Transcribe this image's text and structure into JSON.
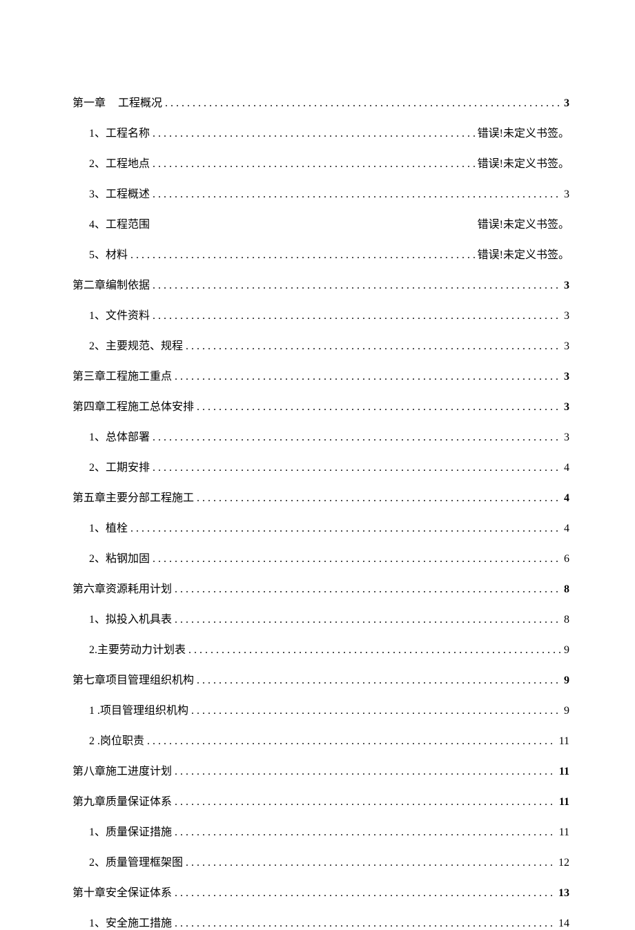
{
  "toc": [
    {
      "level": 1,
      "prefix": "第一章",
      "gap": true,
      "title": "工程概况",
      "page": "3",
      "bold": true,
      "dots": true
    },
    {
      "level": 2,
      "prefix": "1、",
      "gap": false,
      "title": "工程名称",
      "page": "错误!未定义书签。",
      "bold": false,
      "dots": true
    },
    {
      "level": 2,
      "prefix": "2、",
      "gap": false,
      "title": "工程地点",
      "page": "错误!未定义书签。",
      "bold": false,
      "dots": true
    },
    {
      "level": 2,
      "prefix": "3、",
      "gap": false,
      "title": "工程概述",
      "page": "3",
      "bold": false,
      "dots": true
    },
    {
      "level": 2,
      "prefix": "4、",
      "gap": false,
      "title": "工程范围",
      "page": "错误!未定义书签。",
      "bold": false,
      "dots": false
    },
    {
      "level": 2,
      "prefix": "5、",
      "gap": false,
      "title": "材料",
      "page": "错误!未定义书签。",
      "bold": false,
      "dots": true
    },
    {
      "level": 1,
      "prefix": "第二章",
      "gap": false,
      "title": "编制依据",
      "page": "3",
      "bold": true,
      "dots": true
    },
    {
      "level": 2,
      "prefix": "1、",
      "gap": false,
      "title": "文件资料",
      "page": "3",
      "bold": false,
      "dots": true
    },
    {
      "level": 2,
      "prefix": "2、",
      "gap": false,
      "title": "主要规范、规程",
      "page": "3",
      "bold": false,
      "dots": true
    },
    {
      "level": 1,
      "prefix": "第三章",
      "gap": false,
      "title": "工程施工重点",
      "page": "3",
      "bold": true,
      "dots": true
    },
    {
      "level": 1,
      "prefix": "第四章",
      "gap": false,
      "title": "工程施工总体安排",
      "page": "3",
      "bold": true,
      "dots": true
    },
    {
      "level": 2,
      "prefix": "1、",
      "gap": false,
      "title": "总体部署",
      "page": "3",
      "bold": false,
      "dots": true
    },
    {
      "level": 2,
      "prefix": "2、",
      "gap": false,
      "title": "工期安排",
      "page": "4",
      "bold": false,
      "dots": true
    },
    {
      "level": 1,
      "prefix": "第五章",
      "gap": false,
      "title": "主要分部工程施工",
      "page": "4",
      "bold": true,
      "dots": true
    },
    {
      "level": 2,
      "prefix": "1、",
      "gap": false,
      "title": "植栓",
      "page": "4",
      "bold": false,
      "dots": true
    },
    {
      "level": 2,
      "prefix": "2、",
      "gap": false,
      "title": "粘钢加固",
      "page": "6",
      "bold": false,
      "dots": true
    },
    {
      "level": 1,
      "prefix": "第六章",
      "gap": false,
      "title": "资源耗用计划",
      "page": "8",
      "bold": true,
      "dots": true
    },
    {
      "level": 2,
      "prefix": "1、",
      "gap": false,
      "title": "拟投入机具表",
      "page": "8",
      "bold": false,
      "dots": true
    },
    {
      "level": 2,
      "prefix": "2.",
      "gap": false,
      "title": "主要劳动力计划表",
      "page": "9",
      "bold": false,
      "dots": true
    },
    {
      "level": 1,
      "prefix": "第七章",
      "gap": false,
      "title": "项目管理组织机构",
      "page": "9",
      "bold": true,
      "dots": true
    },
    {
      "level": 2,
      "prefix": "1 .",
      "gap": false,
      "title": "项目管理组织机构",
      "page": "9",
      "bold": false,
      "dots": true
    },
    {
      "level": 2,
      "prefix": "2  .",
      "gap": false,
      "title": "岗位职责",
      "page": "11",
      "bold": false,
      "dots": true
    },
    {
      "level": 1,
      "prefix": "第八章",
      "gap": false,
      "title": "施工进度计划",
      "page": "11",
      "bold": true,
      "dots": true
    },
    {
      "level": 1,
      "prefix": "第九章",
      "gap": false,
      "title": "质量保证体系",
      "page": "11",
      "bold": true,
      "dots": true
    },
    {
      "level": 2,
      "prefix": "1、",
      "gap": false,
      "title": "质量保证措施",
      "page": "11",
      "bold": false,
      "dots": true
    },
    {
      "level": 2,
      "prefix": "2、",
      "gap": false,
      "title": "质量管理框架图",
      "page": "12",
      "bold": false,
      "dots": true
    },
    {
      "level": 1,
      "prefix": "第十章",
      "gap": false,
      "title": "安全保证体系",
      "page": "13",
      "bold": true,
      "dots": true
    },
    {
      "level": 2,
      "prefix": "1、",
      "gap": false,
      "title": "安全施工措施",
      "page": "14",
      "bold": false,
      "dots": true
    }
  ],
  "dots_fill": " . . . . . . . . . . . . . . . . . . . . . . . . . . . . . . . . . . . . . . . . . . . . . . . . . . . . . . . . . . . . . . . . . . . . . . . . . . . . . . . . . . . . . . . . . . . . . . . . . . . . . . . . . . . . . . . . . . . . . . . . . . . . ."
}
